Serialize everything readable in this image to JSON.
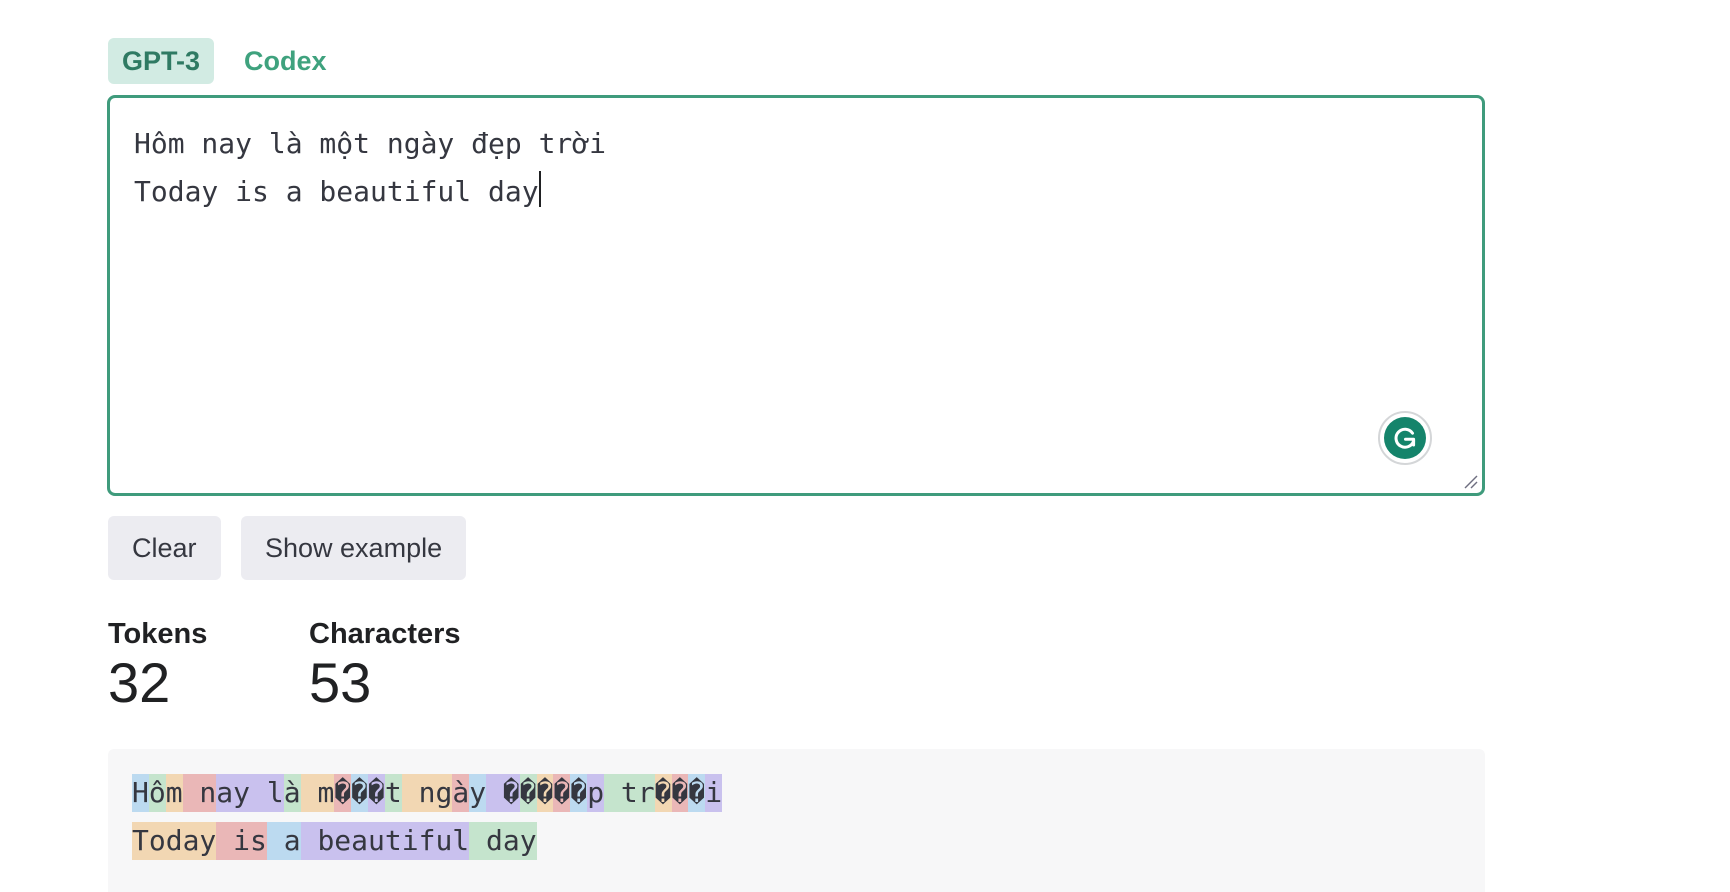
{
  "model_tabs": [
    {
      "label": "GPT-3",
      "active": true
    },
    {
      "label": "Codex",
      "active": false
    }
  ],
  "editor": {
    "lines": [
      "Hôm nay là một ngày đẹp trời",
      "Today is a beautiful day"
    ]
  },
  "buttons": {
    "clear": "Clear",
    "show_example": "Show example"
  },
  "stats": {
    "tokens_label": "Tokens",
    "tokens_value": "32",
    "characters_label": "Characters",
    "characters_value": "53"
  },
  "colors": {
    "accent": "#3f9b7c",
    "token_palette": [
      "#c9c1ee",
      "#c5e4cd",
      "#f2d7b3",
      "#eab7b7",
      "#bcdaf0"
    ]
  },
  "token_lines": [
    [
      {
        "text": "H",
        "color": 4
      },
      {
        "text": "ô",
        "color": 1
      },
      {
        "text": "m",
        "color": 2
      },
      {
        "text": " n",
        "color": 3
      },
      {
        "text": "ay",
        "color": 0
      },
      {
        "text": " l",
        "color": 0
      },
      {
        "text": "à",
        "color": 1
      },
      {
        "text": " m",
        "color": 2
      },
      {
        "text": "�",
        "color": 3
      },
      {
        "text": "�",
        "color": 4
      },
      {
        "text": "�",
        "color": 0
      },
      {
        "text": "t",
        "color": 1
      },
      {
        "text": " ng",
        "color": 2
      },
      {
        "text": "à",
        "color": 3
      },
      {
        "text": "y",
        "color": 4
      },
      {
        "text": " �",
        "color": 0
      },
      {
        "text": "�",
        "color": 1
      },
      {
        "text": "�",
        "color": 2
      },
      {
        "text": "�",
        "color": 3
      },
      {
        "text": "�",
        "color": 4
      },
      {
        "text": "p",
        "color": 0
      },
      {
        "text": " tr",
        "color": 1
      },
      {
        "text": "�",
        "color": 2
      },
      {
        "text": "�",
        "color": 3
      },
      {
        "text": "�",
        "color": 4
      },
      {
        "text": "i",
        "color": 0
      }
    ],
    [
      {
        "text": "Today",
        "color": 2
      },
      {
        "text": " is",
        "color": 3
      },
      {
        "text": " a",
        "color": 4
      },
      {
        "text": " beautiful",
        "color": 0
      },
      {
        "text": " day",
        "color": 1
      }
    ]
  ]
}
